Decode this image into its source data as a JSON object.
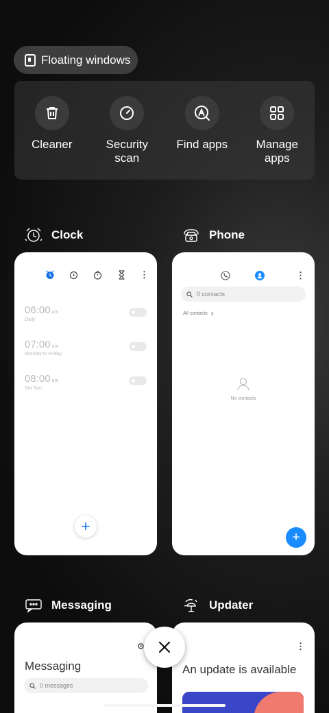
{
  "floating_windows": {
    "label": "Floating windows",
    "icon": "floating-window-icon"
  },
  "tools": [
    {
      "label": "Cleaner",
      "icon": "trash-icon"
    },
    {
      "label": "Security\nscan",
      "icon": "security-scan-icon"
    },
    {
      "label": "Find apps",
      "icon": "find-apps-icon"
    },
    {
      "label": "Manage\napps",
      "icon": "grid-icon"
    }
  ],
  "apps": {
    "clock": {
      "name": "Clock",
      "alarms": [
        {
          "time": "06:00",
          "ampm": "am",
          "repeat": "Daily"
        },
        {
          "time": "07:00",
          "ampm": "am",
          "repeat": "Monday to Friday"
        },
        {
          "time": "08:00",
          "ampm": "am",
          "repeat": "Sat Sun"
        }
      ],
      "fab": "+"
    },
    "phone": {
      "name": "Phone",
      "search_placeholder": "0 contacts",
      "filter": "All contacts",
      "filter_arrows": "⇕",
      "empty": "No contacts",
      "fab": "+"
    },
    "messaging": {
      "name": "Messaging",
      "title": "Messaging",
      "search_placeholder": "0 messages"
    },
    "updater": {
      "name": "Updater",
      "title": "An update is available"
    }
  },
  "colors": {
    "accent_blue": "#1a8cff",
    "banner_blue": "#3a45c8",
    "banner_coral": "#f07a6e"
  }
}
